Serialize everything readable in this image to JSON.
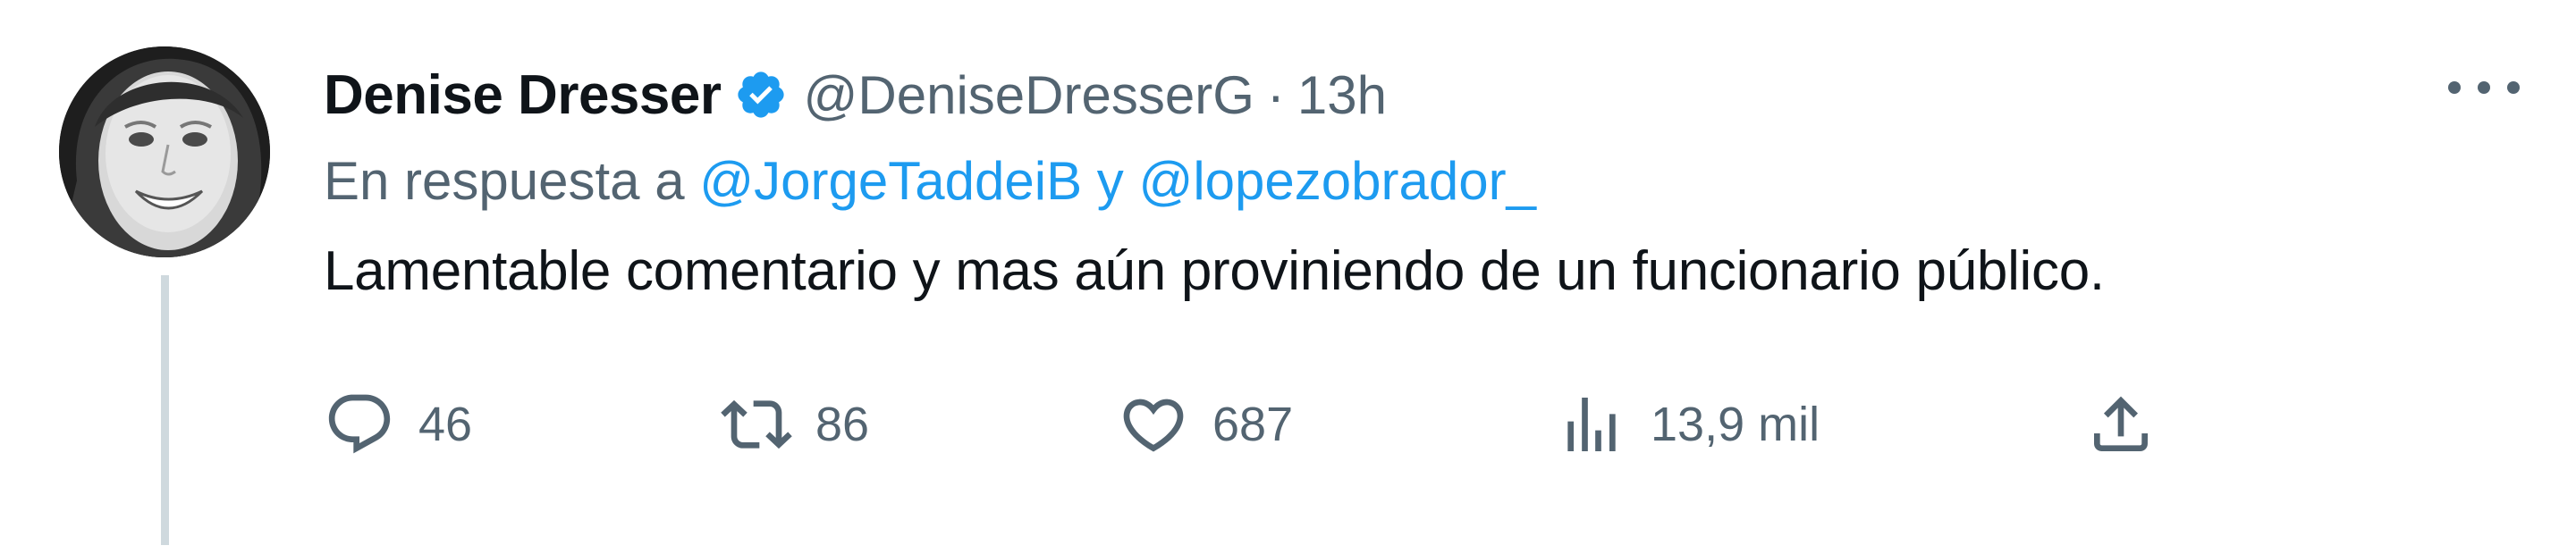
{
  "author": {
    "display_name": "Denise Dresser",
    "handle": "@DeniseDresserG",
    "separator": "·",
    "time": "13h",
    "verified": true,
    "avatar_icon": "person-photo-avatar"
  },
  "reply": {
    "prefix": "En respuesta a",
    "mention1": "@JorgeTaddeiB",
    "conjunction": "y",
    "mention2": "@lopezobrador_"
  },
  "text": "Lamentable comentario y mas aún provinien­do de un funcionario público.",
  "actions": {
    "replies": "46",
    "retweets": "86",
    "likes": "687",
    "views": "13,9 mil"
  },
  "icons": {
    "reply": "speech-bubble-icon",
    "retweet": "retweet-icon",
    "like": "heart-icon",
    "views": "bar-chart-icon",
    "share": "share-upload-icon",
    "more": "more-dots-icon",
    "verified": "verified-badge-icon"
  },
  "colors": {
    "accent": "#1d9bf0",
    "secondary_text": "#536471",
    "primary_text": "#0f1419",
    "thread_line": "#cfd9de"
  }
}
